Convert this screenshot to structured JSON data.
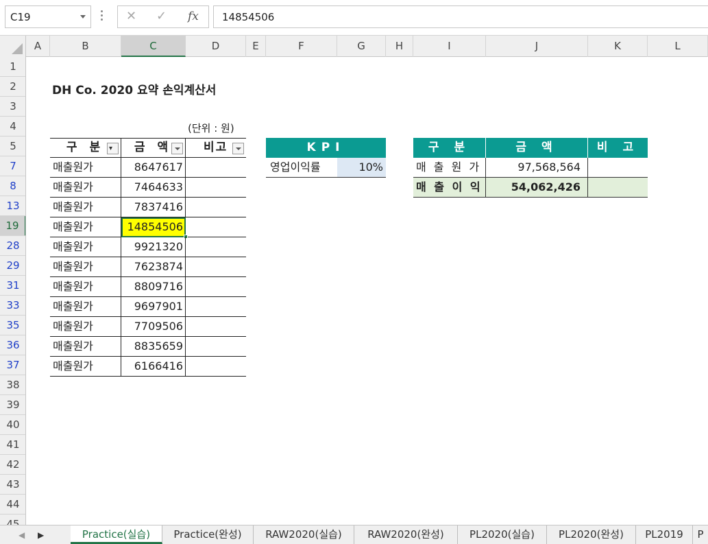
{
  "formula_bar": {
    "name_box": "C19",
    "cancel_icon": "✕",
    "enter_icon": "✓",
    "fx_label": "fx",
    "content": "14854506"
  },
  "columns": [
    "A",
    "B",
    "C",
    "D",
    "E",
    "F",
    "G",
    "H",
    "I",
    "J",
    "K",
    "L"
  ],
  "selected_column": "C",
  "rows": [
    "1",
    "2",
    "3",
    "4",
    "5",
    "7",
    "8",
    "13",
    "19",
    "28",
    "29",
    "31",
    "33",
    "35",
    "36",
    "37",
    "38",
    "39",
    "40",
    "41",
    "42",
    "43",
    "44",
    "45"
  ],
  "filtered_rows": [
    "7",
    "8",
    "13",
    "19",
    "28",
    "29",
    "31",
    "33",
    "35",
    "36",
    "37"
  ],
  "selected_row": "19",
  "sheet": {
    "title": "DH Co. 2020 요약 손익계산서",
    "unit_label": "(단위 : 원)",
    "data_table": {
      "headers": [
        "구 분",
        "금 액",
        "비고"
      ],
      "rows": [
        {
          "category": "매출원가",
          "amount": "8647617",
          "note": ""
        },
        {
          "category": "매출원가",
          "amount": "7464633",
          "note": ""
        },
        {
          "category": "매출원가",
          "amount": "7837416",
          "note": ""
        },
        {
          "category": "매출원가",
          "amount": "14854506",
          "note": ""
        },
        {
          "category": "매출원가",
          "amount": "9921320",
          "note": ""
        },
        {
          "category": "매출원가",
          "amount": "7623874",
          "note": ""
        },
        {
          "category": "매출원가",
          "amount": "8809716",
          "note": ""
        },
        {
          "category": "매출원가",
          "amount": "9697901",
          "note": ""
        },
        {
          "category": "매출원가",
          "amount": "7709506",
          "note": ""
        },
        {
          "category": "매출원가",
          "amount": "8835659",
          "note": ""
        },
        {
          "category": "매출원가",
          "amount": "6166416",
          "note": ""
        }
      ]
    },
    "kpi_table": {
      "header": "KPI",
      "label": "영업이익률",
      "value": "10%"
    },
    "summary_table": {
      "headers": [
        "구 분",
        "금 액",
        "비 고"
      ],
      "rows": [
        {
          "category": "매 출 원 가",
          "amount": "97,568,564",
          "note": ""
        },
        {
          "category": "매 출 이 익",
          "amount": "54,062,426",
          "note": ""
        }
      ]
    }
  },
  "tabs": {
    "nav_prev": "◀",
    "nav_next": "▶",
    "items": [
      "Practice(실습)",
      "Practice(완성)",
      "RAW2020(실습)",
      "RAW2020(완성)",
      "PL2020(실습)",
      "PL2020(완성)",
      "PL2019",
      "P"
    ],
    "active": "Practice(실습)"
  },
  "colors": {
    "accent": "#217346",
    "teal_header": "#0b9b92",
    "active_cell": "#ffff00",
    "kpi_value_bg": "#dde8f4",
    "total_row_bg": "#e2efda"
  }
}
